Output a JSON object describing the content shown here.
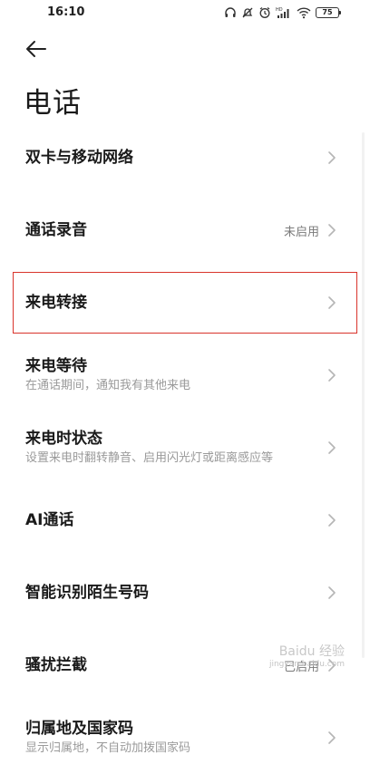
{
  "status_bar": {
    "time": "16:10",
    "battery_level": "75",
    "icons": [
      "headset-icon",
      "mute-icon",
      "alarm-icon",
      "hd-signal-icon",
      "wifi-icon",
      "battery-icon"
    ]
  },
  "header": {
    "back_icon": "arrow-left-icon",
    "title": "电话"
  },
  "settings": {
    "items": [
      {
        "title": "双卡与移动网络",
        "subtitle": "",
        "value": ""
      },
      {
        "title": "通话录音",
        "subtitle": "",
        "value": "未启用"
      },
      {
        "title": "来电转接",
        "subtitle": "",
        "value": ""
      },
      {
        "title": "来电等待",
        "subtitle": "在通话期间，通知我有其他来电",
        "value": ""
      },
      {
        "title": "来电时状态",
        "subtitle": "设置来电时翻转静音、启用闪光灯或距离感应等",
        "value": ""
      },
      {
        "title": "AI通话",
        "subtitle": "",
        "value": ""
      },
      {
        "title": "智能识别陌生号码",
        "subtitle": "",
        "value": ""
      },
      {
        "title": "骚扰拦截",
        "subtitle": "",
        "value": "已启用"
      },
      {
        "title": "归属地及国家码",
        "subtitle": "显示归属地，不自动加拨国家码",
        "value": ""
      }
    ]
  },
  "watermark": {
    "brand": "Baidu 经验",
    "url": "jingyan.baidu.com"
  },
  "colors": {
    "highlight_border": "#d9342b",
    "subtitle": "#9a9a9a",
    "title": "#1a1a1a"
  }
}
